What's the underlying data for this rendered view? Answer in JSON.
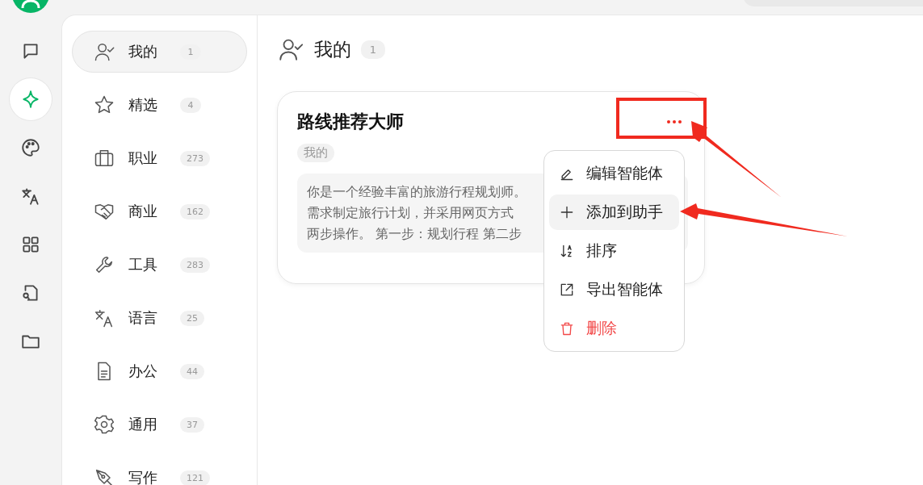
{
  "rail": {
    "items": [
      {
        "kind": "chat",
        "selected": false
      },
      {
        "kind": "sparkle",
        "selected": true
      },
      {
        "kind": "palette",
        "selected": false
      },
      {
        "kind": "translate",
        "selected": false
      },
      {
        "kind": "grid",
        "selected": false
      },
      {
        "kind": "file-search",
        "selected": false
      },
      {
        "kind": "folder",
        "selected": false
      }
    ]
  },
  "categories": [
    {
      "kind": "user-check",
      "label": "我的",
      "count": "1",
      "selected": true
    },
    {
      "kind": "star",
      "label": "精选",
      "count": "4",
      "selected": false
    },
    {
      "kind": "briefcase",
      "label": "职业",
      "count": "273",
      "selected": false
    },
    {
      "kind": "handshake",
      "label": "商业",
      "count": "162",
      "selected": false
    },
    {
      "kind": "wrench",
      "label": "工具",
      "count": "283",
      "selected": false
    },
    {
      "kind": "translate",
      "label": "语言",
      "count": "25",
      "selected": false
    },
    {
      "kind": "document",
      "label": "办公",
      "count": "44",
      "selected": false
    },
    {
      "kind": "gear",
      "label": "通用",
      "count": "37",
      "selected": false
    },
    {
      "kind": "pen",
      "label": "写作",
      "count": "121",
      "selected": false
    }
  ],
  "heading": {
    "title": "我的",
    "count": "1"
  },
  "card": {
    "title": "路线推荐大师",
    "tag": "我的",
    "description_lines": [
      "你是一个经验丰富的旅游行程规划师。",
      "需求制定旅行计划，并采用网页方式",
      "两步操作。 第一步：规划行程 第二步"
    ]
  },
  "menu": [
    {
      "kind": "edit",
      "label": "编辑智能体",
      "highlighted": false,
      "danger": false
    },
    {
      "kind": "plus",
      "label": "添加到助手",
      "highlighted": true,
      "danger": false
    },
    {
      "kind": "sort",
      "label": "排序",
      "highlighted": false,
      "danger": false
    },
    {
      "kind": "export",
      "label": "导出智能体",
      "highlighted": false,
      "danger": false
    },
    {
      "kind": "trash",
      "label": "删除",
      "highlighted": false,
      "danger": true
    }
  ]
}
